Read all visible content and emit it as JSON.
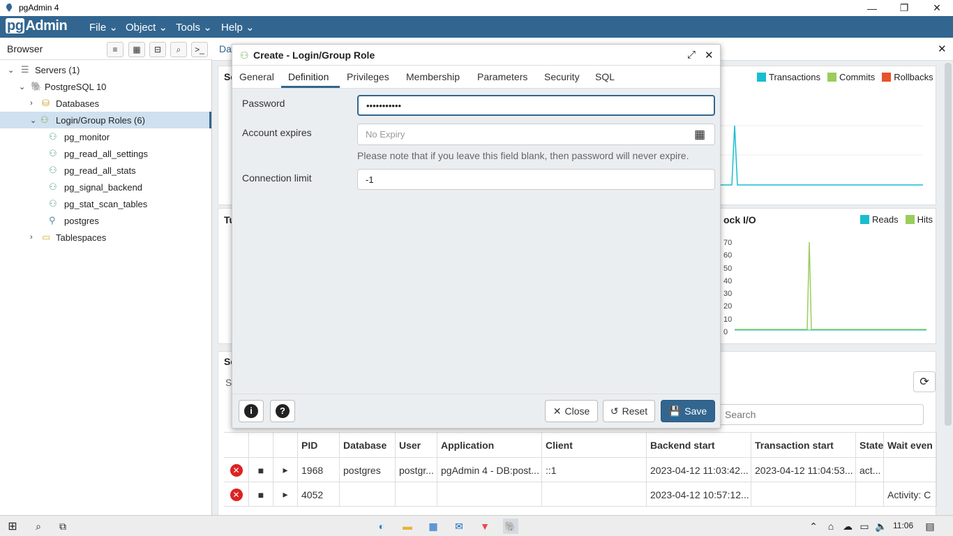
{
  "window": {
    "title": "pgAdmin 4",
    "minimize": "—",
    "maximize": "❐",
    "close": "✕"
  },
  "menubar": {
    "brand_pg": "pg",
    "brand_rest": "Admin",
    "items": [
      "File",
      "Object",
      "Tools",
      "Help"
    ]
  },
  "browser": {
    "title": "Browser",
    "tree": [
      {
        "label": "Servers (1)"
      },
      {
        "label": "PostgreSQL 10"
      },
      {
        "label": "Databases"
      },
      {
        "label": "Login/Group Roles (6)"
      },
      {
        "label": "pg_monitor"
      },
      {
        "label": "pg_read_all_settings"
      },
      {
        "label": "pg_read_all_stats"
      },
      {
        "label": "pg_signal_backend"
      },
      {
        "label": "pg_stat_scan_tables"
      },
      {
        "label": "postgres"
      },
      {
        "label": "Tablespaces"
      }
    ]
  },
  "dashboard": {
    "tab_partial": "Da",
    "card1_partial": "Se",
    "card2_partial": "Tu",
    "card3_partial": "Se",
    "card3_sub_partial": "S",
    "block_io_partial": "ock I/O",
    "legend1": [
      "Transactions",
      "Commits",
      "Rollbacks"
    ],
    "legend2": [
      "Reads",
      "Hits"
    ],
    "yticks_partial": [
      "70",
      "60",
      "50",
      "40",
      "30",
      "20",
      "10",
      "0"
    ],
    "search_placeholder": "Search",
    "columns": [
      "PID",
      "Database",
      "User",
      "Application",
      "Client",
      "Backend start",
      "Transaction start",
      "State",
      "Wait even"
    ],
    "rows": [
      {
        "pid": "1968",
        "database": "postgres",
        "user": "postgr...",
        "application": "pgAdmin 4 - DB:post...",
        "client": "::1",
        "backend_start": "2023-04-12 11:03:42...",
        "transaction_start": "2023-04-12 11:04:53...",
        "state": "act...",
        "wait": ""
      },
      {
        "pid": "4052",
        "database": "",
        "user": "",
        "application": "",
        "client": "",
        "backend_start": "2023-04-12 10:57:12...",
        "transaction_start": "",
        "state": "",
        "wait": "Activity: C"
      }
    ]
  },
  "dialog": {
    "title": "Create - Login/Group Role",
    "tabs": [
      "General",
      "Definition",
      "Privileges",
      "Membership",
      "Parameters",
      "Security",
      "SQL"
    ],
    "password_label": "Password",
    "password_value": "•••••••••••",
    "expires_label": "Account expires",
    "expires_placeholder": "No Expiry",
    "expires_note": "Please note that if you leave this field blank, then password will never expire.",
    "connlimit_label": "Connection limit",
    "connlimit_value": "-1",
    "close_label": "Close",
    "reset_label": "Reset",
    "save_label": "Save"
  },
  "taskbar": {
    "time": "11:06"
  },
  "colors": {
    "brand": "#326690",
    "transactions": "#17becf",
    "commits": "#9acd5b",
    "rollbacks": "#e8542a"
  }
}
